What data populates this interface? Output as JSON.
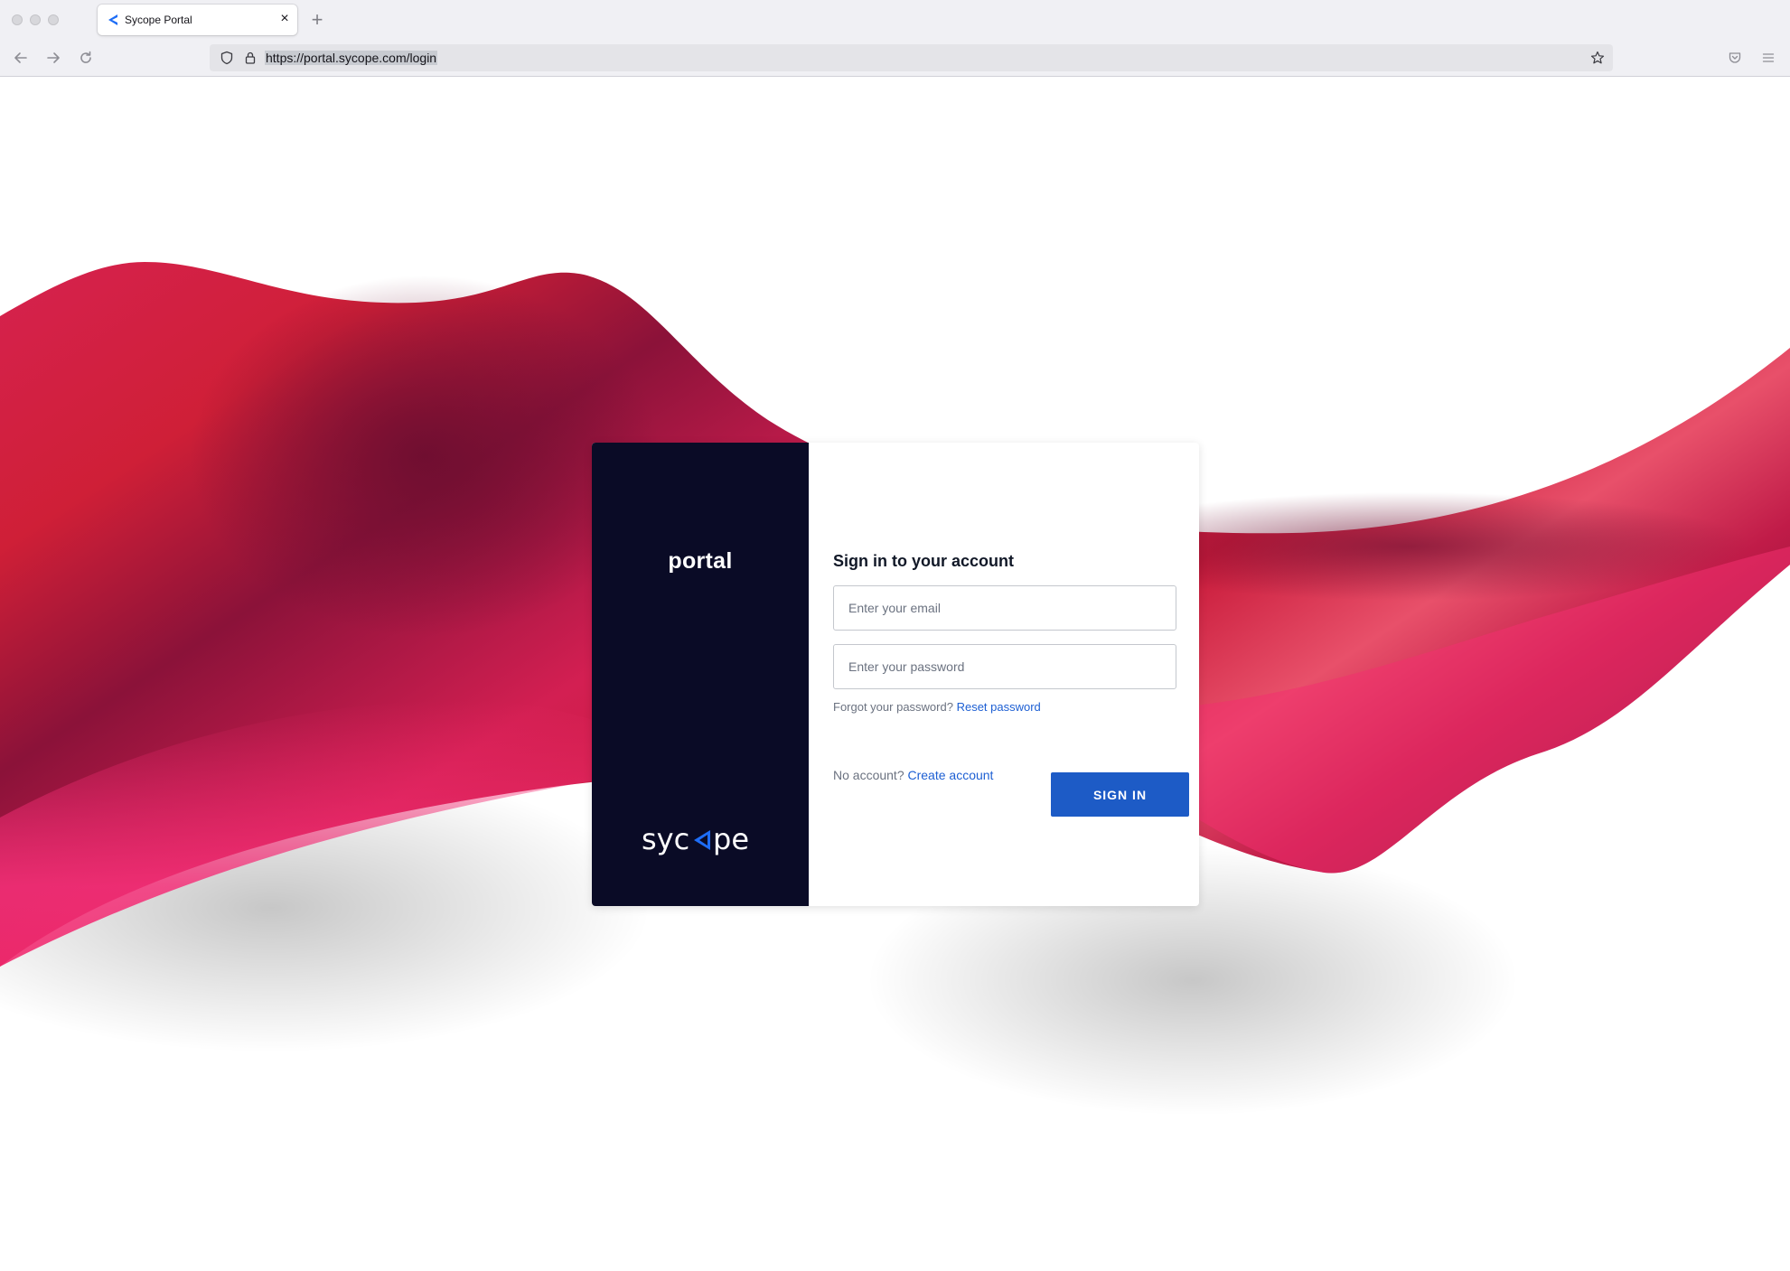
{
  "browser": {
    "tab_title": "Sycope Portal",
    "tab_close_glyph": "×",
    "new_tab_glyph": "+",
    "url": "https://portal.sycope.com/login",
    "icons": {
      "back": "arrow-left-icon",
      "forward": "arrow-right-icon",
      "reload": "reload-icon",
      "tracking_protection": "shield-icon",
      "secure": "lock-icon",
      "bookmark": "star-icon",
      "pocket": "pocket-icon",
      "menu": "hamburger-menu-icon"
    }
  },
  "login": {
    "app_name": "portal",
    "brand": "sycope",
    "title": "Sign in to your account",
    "email_placeholder": "Enter your email",
    "email_value": "",
    "password_placeholder": "Enter your password",
    "password_value": "",
    "forgot_text": "Forgot your password?",
    "reset_link": "Reset password",
    "no_account_text": "No account?",
    "create_link": "Create account",
    "signin_button": "SIGN IN"
  },
  "colors": {
    "card_left_bg": "#0a0b26",
    "primary_button": "#1d5bc6",
    "link": "#1d5fd3",
    "wave_pink": "#f02a6e",
    "wave_crimson": "#d6224f",
    "wave_dark": "#8b1239"
  }
}
